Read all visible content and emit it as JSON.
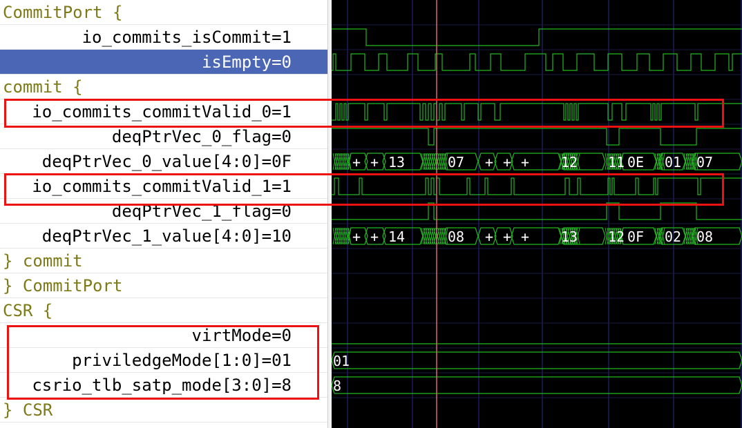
{
  "signals": [
    {
      "label": "CommitPort {",
      "type": "group",
      "indent": 4
    },
    {
      "label": "io_commits_isCommit=1",
      "type": "signal",
      "align": "right"
    },
    {
      "label": "isEmpty=0",
      "type": "signal",
      "align": "right",
      "selected": true
    },
    {
      "label": "commit {",
      "type": "group",
      "indent": 4
    },
    {
      "label": "io_commits_commitValid_0=1",
      "type": "signal",
      "align": "right"
    },
    {
      "label": "deqPtrVec_0_flag=0",
      "type": "signal",
      "align": "right"
    },
    {
      "label": "deqPtrVec_0_value[4:0]=0F",
      "type": "signal",
      "align": "right"
    },
    {
      "label": "io_commits_commitValid_1=1",
      "type": "signal",
      "align": "right"
    },
    {
      "label": "deqPtrVec_1_flag=0",
      "type": "signal",
      "align": "right"
    },
    {
      "label": "deqPtrVec_1_value[4:0]=10",
      "type": "signal",
      "align": "right"
    },
    {
      "label": "} commit",
      "type": "group",
      "indent": 4
    },
    {
      "label": "} CommitPort",
      "type": "group",
      "indent": 4
    },
    {
      "label": "CSR {",
      "type": "group",
      "indent": 4
    },
    {
      "label": "virtMode=0",
      "type": "signal",
      "align": "right"
    },
    {
      "label": "priviledgeMode[1:0]=01",
      "type": "signal",
      "align": "right"
    },
    {
      "label": "csrio_tlb_satp_mode[3:0]=8",
      "type": "signal",
      "align": "right"
    },
    {
      "label": "} CSR",
      "type": "group",
      "indent": 4
    }
  ],
  "waves": {
    "deqPtrVec_0_value": [
      "+",
      "+",
      "13",
      "07",
      "+",
      "+",
      "+",
      "12",
      "11",
      "0E",
      "01",
      "07"
    ],
    "deqPtrVec_1_value": [
      "+",
      "+",
      "14",
      "08",
      "+",
      "+",
      "+",
      "13",
      "12",
      "0F",
      "02",
      "08"
    ],
    "priviledgeMode": "01",
    "csrio_tlb_satp_mode": "8"
  },
  "colors": {
    "wave": "#22b722",
    "cursor": "#d86c6c",
    "grid": "#2c2c8c",
    "selection": "#4a66b5",
    "group_text": "#7d7a17",
    "highlight": "#ee1111"
  },
  "icons": [
    "red-highlight-box"
  ]
}
